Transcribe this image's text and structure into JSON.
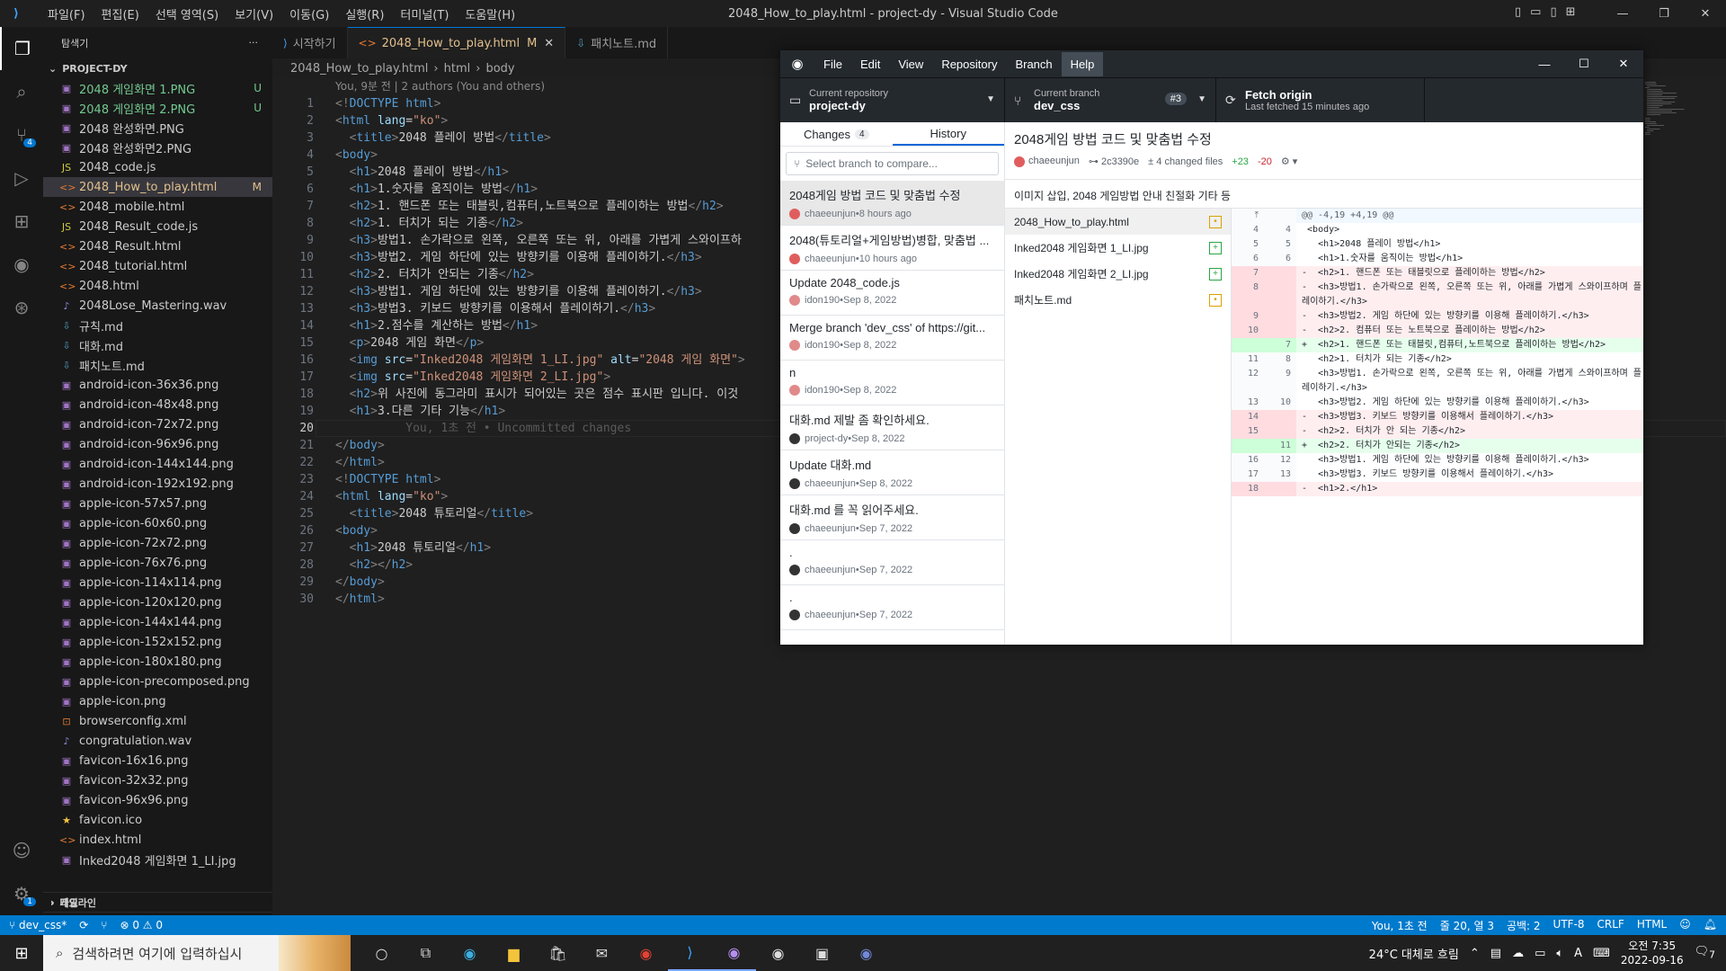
{
  "titlebar": {
    "menu": [
      "파일(F)",
      "편집(E)",
      "선택 영역(S)",
      "보기(V)",
      "이동(G)",
      "실행(R)",
      "터미널(T)",
      "도움말(H)"
    ],
    "title": "2048_How_to_play.html - project-dy - Visual Studio Code"
  },
  "explorer": {
    "header": "탐색기",
    "project": "PROJECT-DY",
    "files": [
      {
        "name": "2048 게임화면 1.PNG",
        "status": "U",
        "kind": "img",
        "state": "new"
      },
      {
        "name": "2048 게임화면 2.PNG",
        "status": "U",
        "kind": "img",
        "state": "new"
      },
      {
        "name": "2048 완성화면.PNG",
        "status": "",
        "kind": "img",
        "state": ""
      },
      {
        "name": "2048 완성화면2.PNG",
        "status": "",
        "kind": "img",
        "state": ""
      },
      {
        "name": "2048_code.js",
        "status": "",
        "kind": "js",
        "state": ""
      },
      {
        "name": "2048_How_to_play.html",
        "status": "M",
        "kind": "html",
        "state": "mod sel"
      },
      {
        "name": "2048_mobile.html",
        "status": "",
        "kind": "html",
        "state": ""
      },
      {
        "name": "2048_Result_code.js",
        "status": "",
        "kind": "js",
        "state": ""
      },
      {
        "name": "2048_Result.html",
        "status": "",
        "kind": "html",
        "state": ""
      },
      {
        "name": "2048_tutorial.html",
        "status": "",
        "kind": "html",
        "state": ""
      },
      {
        "name": "2048.html",
        "status": "",
        "kind": "html",
        "state": ""
      },
      {
        "name": "2048Lose_Mastering.wav",
        "status": "",
        "kind": "wav",
        "state": ""
      },
      {
        "name": "규칙.md",
        "status": "",
        "kind": "md",
        "state": ""
      },
      {
        "name": "대화.md",
        "status": "",
        "kind": "md",
        "state": ""
      },
      {
        "name": "패치노트.md",
        "status": "",
        "kind": "md",
        "state": ""
      },
      {
        "name": "android-icon-36x36.png",
        "status": "",
        "kind": "img",
        "state": ""
      },
      {
        "name": "android-icon-48x48.png",
        "status": "",
        "kind": "img",
        "state": ""
      },
      {
        "name": "android-icon-72x72.png",
        "status": "",
        "kind": "img",
        "state": ""
      },
      {
        "name": "android-icon-96x96.png",
        "status": "",
        "kind": "img",
        "state": ""
      },
      {
        "name": "android-icon-144x144.png",
        "status": "",
        "kind": "img",
        "state": ""
      },
      {
        "name": "android-icon-192x192.png",
        "status": "",
        "kind": "img",
        "state": ""
      },
      {
        "name": "apple-icon-57x57.png",
        "status": "",
        "kind": "img",
        "state": ""
      },
      {
        "name": "apple-icon-60x60.png",
        "status": "",
        "kind": "img",
        "state": ""
      },
      {
        "name": "apple-icon-72x72.png",
        "status": "",
        "kind": "img",
        "state": ""
      },
      {
        "name": "apple-icon-76x76.png",
        "status": "",
        "kind": "img",
        "state": ""
      },
      {
        "name": "apple-icon-114x114.png",
        "status": "",
        "kind": "img",
        "state": ""
      },
      {
        "name": "apple-icon-120x120.png",
        "status": "",
        "kind": "img",
        "state": ""
      },
      {
        "name": "apple-icon-144x144.png",
        "status": "",
        "kind": "img",
        "state": ""
      },
      {
        "name": "apple-icon-152x152.png",
        "status": "",
        "kind": "img",
        "state": ""
      },
      {
        "name": "apple-icon-180x180.png",
        "status": "",
        "kind": "img",
        "state": ""
      },
      {
        "name": "apple-icon-precomposed.png",
        "status": "",
        "kind": "img",
        "state": ""
      },
      {
        "name": "apple-icon.png",
        "status": "",
        "kind": "img",
        "state": ""
      },
      {
        "name": "browserconfig.xml",
        "status": "",
        "kind": "xml",
        "state": ""
      },
      {
        "name": "congratulation.wav",
        "status": "",
        "kind": "wav",
        "state": ""
      },
      {
        "name": "favicon-16x16.png",
        "status": "",
        "kind": "img",
        "state": ""
      },
      {
        "name": "favicon-32x32.png",
        "status": "",
        "kind": "img",
        "state": ""
      },
      {
        "name": "favicon-96x96.png",
        "status": "",
        "kind": "img",
        "state": ""
      },
      {
        "name": "favicon.ico",
        "status": "",
        "kind": "ico",
        "state": ""
      },
      {
        "name": "index.html",
        "status": "",
        "kind": "html",
        "state": ""
      },
      {
        "name": "Inked2048 게임화면 1_LI.jpg",
        "status": "",
        "kind": "img",
        "state": ""
      }
    ],
    "outline": "개요",
    "timeline": "타임라인"
  },
  "tabs": [
    {
      "label": "시작하기",
      "icon": "vscode-icon",
      "active": false,
      "modified": ""
    },
    {
      "label": "2048_How_to_play.html",
      "icon": "html-icon",
      "active": true,
      "modified": "M"
    },
    {
      "label": "패치노트.md",
      "icon": "markdown-icon",
      "active": false,
      "modified": ""
    }
  ],
  "breadcrumb": [
    "2048_How_to_play.html",
    "html",
    "body"
  ],
  "editor": {
    "blame_header": "You, 9분 전 | 2 authors (You and others)",
    "current_line": 20,
    "ghost_text": "You, 1초 전 • Uncommitted changes",
    "lines": [
      "<!DOCTYPE html>",
      "<html lang=\"ko\">",
      "  <title>2048 플레이 방법</title>",
      "<body>",
      "  <h1>2048 플레이 방법</h1>",
      "  <h1>1.숫자를 움직이는 방법</h1>",
      "  <h2>1. 핸드폰 또는 태블릿,컴퓨터,노트북으로 플레이하는 방법</h2>",
      "  <h2>1. 터치가 되는 기종</h2>",
      "  <h3>방법1. 손가락으로 왼쪽, 오른쪽 또는 위, 아래를 가볍게 스와이프하",
      "  <h3>방법2. 게임 하단에 있는 방향키를 이용해 플레이하기.</h3>",
      "  <h2>2. 터치가 안되는 기종</h2>",
      "  <h3>방법1. 게임 하단에 있는 방향키를 이용해 플레이하기.</h3>",
      "  <h3>방법3. 키보드 방향키를 이용해서 플레이하기.</h3>",
      "  <h1>2.점수를 계산하는 방법</h1>",
      "  <p>2048 게임 화면</p>",
      "  <img src=\"Inked2048 게임화면 1_LI.jpg\" alt=\"2048 게임 화면\">",
      "  <img src=\"Inked2048 게임화면 2_LI.jpg\">",
      "  <h2>위 사진에 동그라미 표시가 되어있는 곳은 점수 표시판 입니다. 이것",
      "  <h1>3.다른 기타 기능</h1>",
      "",
      "</body>",
      "</html>",
      "<!DOCTYPE html>",
      "<html lang=\"ko\">",
      "  <title>2048 튜토리얼</title>",
      "<body>",
      "  <h1>2048 튜토리얼</h1>",
      "  <h2></h2>",
      "</body>",
      "</html>"
    ]
  },
  "statusbar": {
    "branch": "dev_css*",
    "problems": "⊗ 0 ⚠ 0",
    "blame": "You, 1초 전",
    "position": "줄 20, 열 3",
    "spaces": "공백: 2",
    "encoding": "UTF-8",
    "eol": "CRLF",
    "language": "HTML"
  },
  "github": {
    "menu": [
      "File",
      "Edit",
      "View",
      "Repository",
      "Branch",
      "Help"
    ],
    "repo_label": "Current repository",
    "repo": "project-dy",
    "branch_label": "Current branch",
    "branch": "dev_css",
    "pr": "#3",
    "fetch_label": "Fetch origin",
    "fetch_sub": "Last fetched 15 minutes ago",
    "tab_changes": "Changes",
    "changes_count": "4",
    "tab_history": "History",
    "branch_compare_placeholder": "Select branch to compare...",
    "commits": [
      {
        "summary": "2048게임 방법 코드 및 맞춤법 수정",
        "author": "chaeeunjun",
        "time": "8 hours ago",
        "avatar": "#e05d5d"
      },
      {
        "summary": "2048(튜토리얼+게임방법)병합, 맞춤법 ...",
        "author": "chaeeunjun",
        "time": "10 hours ago",
        "avatar": "#e05d5d"
      },
      {
        "summary": "Update 2048_code.js",
        "author": "idon190",
        "time": "Sep 8, 2022",
        "avatar": "#e08a8a"
      },
      {
        "summary": "Merge branch 'dev_css' of https://git...",
        "author": "idon190",
        "time": "Sep 8, 2022",
        "avatar": "#e08a8a"
      },
      {
        "summary": "n",
        "author": "idon190",
        "time": "Sep 8, 2022",
        "avatar": "#e08a8a"
      },
      {
        "summary": "대화.md 제발 좀 확인하세요.",
        "author": "project-dy",
        "time": "Sep 8, 2022",
        "avatar": "#333333"
      },
      {
        "summary": "Update 대화.md",
        "author": "chaeeunjun",
        "time": "Sep 8, 2022",
        "avatar": "#333333"
      },
      {
        "summary": "대화.md 를 꼭 읽어주세요.",
        "author": "chaeeunjun",
        "time": "Sep 7, 2022",
        "avatar": "#333333"
      },
      {
        "summary": ".",
        "author": "chaeeunjun",
        "time": "Sep 7, 2022",
        "avatar": "#333333"
      },
      {
        "summary": ".",
        "author": "chaeeunjun",
        "time": "Sep 7, 2022",
        "avatar": "#333333"
      }
    ],
    "commit_title": "2048게임 방법 코드 및 맞춤법 수정",
    "commit_author": "chaeeunjun",
    "commit_sha": "2c3390e",
    "commit_files": "4 changed files",
    "commit_add": "+23",
    "commit_del": "-20",
    "commit_desc": "이미지 삽입, 2048 게임방법 안내 친절화 기타 등",
    "changed_files": [
      {
        "name": "2048_How_to_play.html",
        "status": "m"
      },
      {
        "name": "Inked2048 게임화면 1_LI.jpg",
        "status": "a"
      },
      {
        "name": "Inked2048 게임화면 2_LI.jpg",
        "status": "a"
      },
      {
        "name": "패치노트.md",
        "status": "m"
      }
    ],
    "diff": [
      {
        "type": "hunk",
        "o": "",
        "n": "",
        "text": "@@ -4,19 +4,19 @@"
      },
      {
        "type": "ctx",
        "o": "4",
        "n": "4",
        "text": " <body>"
      },
      {
        "type": "ctx",
        "o": "5",
        "n": "5",
        "text": "   <h1>2048 플레이 방법</h1>"
      },
      {
        "type": "ctx",
        "o": "6",
        "n": "6",
        "text": "   <h1>1.숫자를 움직이는 방법</h1>"
      },
      {
        "type": "del",
        "o": "7",
        "n": "",
        "text": "-  <h2>1. 핸드폰 또는 태블릿으로 플레이하는 방법</h2>"
      },
      {
        "type": "del",
        "o": "8",
        "n": "",
        "text": "-  <h3>방법1. 손가락으로 왼쪽, 오른쪽 또는 위, 아래를 가볍게 스와이프하며 플레이하기.</h3>"
      },
      {
        "type": "del",
        "o": "9",
        "n": "",
        "text": "-  <h3>방법2. 게임 하단에 있는 방향키를 이용해 플레이하기.</h3>"
      },
      {
        "type": "del",
        "o": "10",
        "n": "",
        "text": "-  <h2>2. 컴퓨터 또는 노트북으로 플레이하는 방법</h2>"
      },
      {
        "type": "add",
        "o": "",
        "n": "7",
        "text": "+  <h2>1. 핸드폰 또는 태블릿,컴퓨터,노트북으로 플레이하는 방법</h2>"
      },
      {
        "type": "ctx",
        "o": "11",
        "n": "8",
        "text": "   <h2>1. 터치가 되는 기종</h2>"
      },
      {
        "type": "ctx",
        "o": "12",
        "n": "9",
        "text": "   <h3>방법1. 손가락으로 왼쪽, 오른쪽 또는 위, 아래를 가볍게 스와이프하며 플레이하기.</h3>"
      },
      {
        "type": "ctx",
        "o": "13",
        "n": "10",
        "text": "   <h3>방법2. 게임 하단에 있는 방향키를 이용해 플레이하기.</h3>"
      },
      {
        "type": "del",
        "o": "14",
        "n": "",
        "text": "-  <h3>방법3. 키보드 방향키를 이용해서 플레이하기.</h3>"
      },
      {
        "type": "del",
        "o": "15",
        "n": "",
        "text": "-  <h2>2. 터치가 안 되는 기종</h2>"
      },
      {
        "type": "add",
        "o": "",
        "n": "11",
        "text": "+  <h2>2. 터치가 안되는 기종</h2>"
      },
      {
        "type": "ctx",
        "o": "16",
        "n": "12",
        "text": "   <h3>방법1. 게임 하단에 있는 방향키를 이용해 플레이하기.</h3>"
      },
      {
        "type": "ctx",
        "o": "17",
        "n": "13",
        "text": "   <h3>방법3. 키보드 방향키를 이용해서 플레이하기.</h3>"
      },
      {
        "type": "del",
        "o": "18",
        "n": "",
        "text": "-  <h1>2.</h1>"
      }
    ]
  },
  "taskbar": {
    "search_placeholder": "검색하려면 여기에 입력하십시",
    "weather": "24°C 대체로 흐림",
    "time": "오전 7:35",
    "date": "2022-09-16",
    "notifications": "7"
  }
}
